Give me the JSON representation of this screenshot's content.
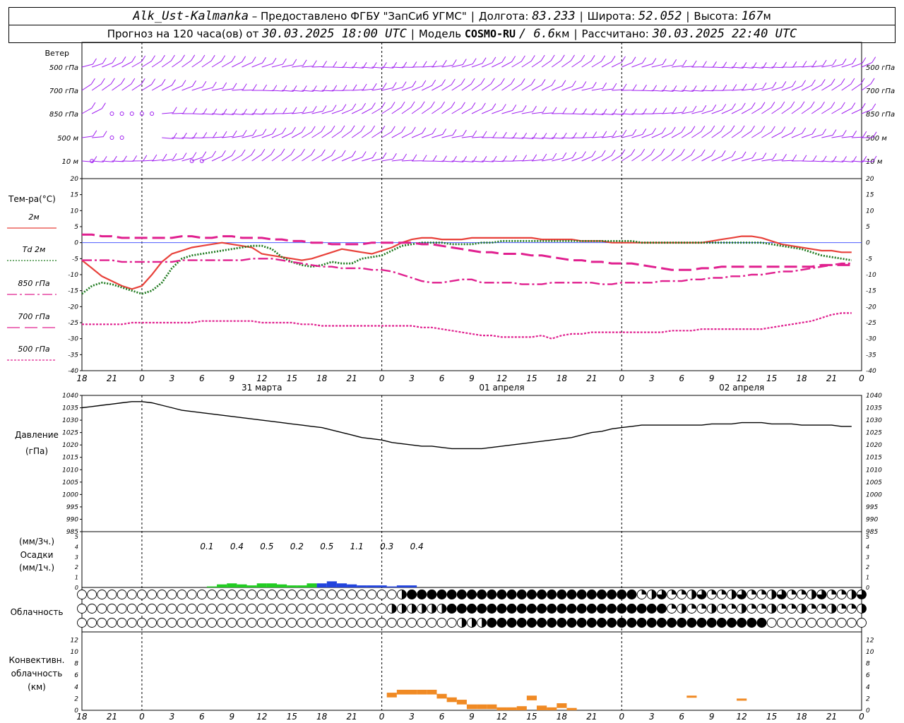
{
  "header": {
    "station": "Alk_Ust-Kalmanka",
    "provider": "– Предоставлено ФГБУ \"ЗапСиб УГМС\"",
    "lon_label": "Долгота:",
    "lon_value": "83.233",
    "lat_label": "Широта:",
    "lat_value": "52.052",
    "alt_label": "Высота:",
    "alt_value": "167",
    "alt_unit": "м",
    "forecast_prefix": "Прогноз на 120 часа(ов) от",
    "forecast_time": "30.03.2025 18:00 UTC",
    "model_label": "Модель",
    "model_name": "COSMO-RU",
    "model_res": "/ 6.6",
    "model_res_unit": "км",
    "calc_label": "Рассчитано:",
    "calc_time": "30.03.2025 22:40 UTC"
  },
  "colors": {
    "wind": "#a020f0",
    "t2m": "#e8413a",
    "td2m": "#1f7a1f",
    "t850": "#e0208f",
    "t700": "#e0208f",
    "t500": "#e0208f",
    "pressure": "#000000",
    "precip_green": "#22cc22",
    "precip_blue": "#2244dd",
    "conv": "#f08a24"
  },
  "wind_panel": {
    "title": "Ветер",
    "levels": [
      "500 гПа",
      "700 гПа",
      "850 гПа",
      "500 м",
      "10  м"
    ]
  },
  "temp_panel": {
    "title": "Тем-ра(°С)",
    "legend": [
      {
        "label": "2м",
        "style": "solid"
      },
      {
        "label": "Td  2м",
        "style": "dotted"
      },
      {
        "label": "850 гПа",
        "style": "dash-dot"
      },
      {
        "label": "700 гПа",
        "style": "long-dash"
      },
      {
        "label": "500 гПа",
        "style": "short-dash"
      }
    ],
    "yticks": [
      20,
      15,
      10,
      5,
      0,
      -5,
      -10,
      -15,
      -20,
      -25,
      -30,
      -35,
      -40
    ]
  },
  "pressure_panel": {
    "title": "Давление",
    "unit": "(гПа)",
    "yticks": [
      1040,
      1035,
      1030,
      1025,
      1020,
      1015,
      1010,
      1005,
      1000,
      995,
      990,
      985
    ]
  },
  "precip_panel": {
    "unit3": "(мм/3ч.)",
    "title": "Осадки",
    "unit1": "(мм/1ч.)",
    "yticks": [
      5,
      4,
      3,
      2,
      1,
      0
    ],
    "labels": [
      "0.1",
      "0.4",
      "0.5",
      "0.2",
      "0.5",
      "1.1",
      "0.3",
      "0.4"
    ]
  },
  "cloud_panel": {
    "title": "Облачность"
  },
  "conv_panel": {
    "title1": "Конвективн.",
    "title2": "облачность",
    "unit": "(км)",
    "yticks": [
      12,
      10,
      8,
      6,
      4,
      2,
      0
    ]
  },
  "time_axis": {
    "hour_ticks": [
      "18",
      "21",
      "0",
      "3",
      "6",
      "9",
      "12",
      "15",
      "18",
      "21",
      "0",
      "3",
      "6",
      "9",
      "12",
      "15",
      "18",
      "21",
      "0",
      "3",
      "6",
      "9",
      "12",
      "15",
      "18",
      "21",
      "0"
    ],
    "dates": [
      "31 марта",
      "01 апреля",
      "02 апреля"
    ]
  },
  "chart_data": {
    "type": "line",
    "title": "Alk_Ust-Kalmanka",
    "x_hours_from_start": [
      0,
      78
    ],
    "series": [
      {
        "name": "2м",
        "unit": "°С",
        "values": [
          -5.5,
          -8,
          -10.5,
          -12,
          -13.5,
          -14.5,
          -13.5,
          -10,
          -6,
          -3.5,
          -2.5,
          -1.5,
          -1,
          -0.5,
          0,
          -0.5,
          -1,
          -1.5,
          -3.5,
          -4,
          -4.5,
          -5,
          -5.5,
          -5,
          -4,
          -3,
          -2,
          -2.5,
          -3,
          -3.5,
          -2.5,
          -1.5,
          0,
          1,
          1.5,
          1.5,
          1,
          1,
          1,
          1.5,
          1.5,
          1.5,
          1.5,
          1.5,
          1.5,
          1.5,
          1,
          1,
          1,
          1,
          0.5,
          0.5,
          0.5,
          0,
          0,
          0,
          0,
          0,
          0,
          0,
          0,
          0,
          0,
          0.5,
          1,
          1.5,
          2,
          2,
          1.5,
          0.5,
          -0.5,
          -1,
          -1.5,
          -2,
          -2.5,
          -2.5,
          -3,
          -3
        ]
      },
      {
        "name": "Td  2м",
        "unit": "°С",
        "values": [
          -16,
          -13.5,
          -12.5,
          -13,
          -14,
          -15,
          -16,
          -15,
          -12.5,
          -8,
          -5,
          -4,
          -3.5,
          -3,
          -2.5,
          -2,
          -1.5,
          -1,
          -1,
          -2,
          -4.5,
          -6,
          -7,
          -7.5,
          -7,
          -6,
          -6.5,
          -6.5,
          -5,
          -4.5,
          -4,
          -2.5,
          -1,
          -0.5,
          0,
          0,
          0,
          -0.5,
          -0.5,
          -0.5,
          0,
          0,
          0.5,
          0.5,
          0.5,
          0.5,
          0.5,
          0.5,
          0.5,
          0.5,
          0.5,
          0.5,
          0.5,
          0.5,
          0.5,
          0.5,
          0,
          0,
          0,
          0,
          0,
          0,
          0,
          0,
          0,
          0,
          0,
          0,
          0,
          -0.5,
          -1,
          -1.5,
          -2,
          -3,
          -4,
          -4.5,
          -5,
          -5.5
        ]
      },
      {
        "name": "850 гПа",
        "unit": "°С",
        "values": [
          -5.5,
          -5.5,
          -5.5,
          -5.5,
          -6,
          -6,
          -6,
          -6,
          -6,
          -6,
          -5.5,
          -5.5,
          -5.5,
          -5.5,
          -5.5,
          -5.5,
          -5.5,
          -5,
          -5,
          -5,
          -5.5,
          -6,
          -6.5,
          -7,
          -7.5,
          -7.5,
          -8,
          -8,
          -8,
          -8.5,
          -8.5,
          -9,
          -10,
          -11,
          -12,
          -12.5,
          -12.5,
          -12,
          -11.5,
          -11.5,
          -12.5,
          -12.5,
          -12.5,
          -12.5,
          -13,
          -13,
          -13,
          -12.5,
          -12.5,
          -12.5,
          -12.5,
          -12.5,
          -13,
          -13,
          -12.5,
          -12.5,
          -12.5,
          -12.5,
          -12,
          -12,
          -12,
          -11.5,
          -11.5,
          -11,
          -11,
          -10.5,
          -10.5,
          -10,
          -10,
          -9.5,
          -9,
          -9,
          -8.5,
          -8,
          -7.5,
          -7,
          -6.5,
          -6.5
        ]
      },
      {
        "name": "700 гПа",
        "unit": "°С",
        "values": [
          2.5,
          2.5,
          2,
          2,
          1.5,
          1.5,
          1.5,
          1.5,
          1.5,
          1.5,
          2,
          2,
          1.5,
          1.5,
          2,
          2,
          1.5,
          1.5,
          1.5,
          1,
          1,
          0.5,
          0.5,
          0,
          0,
          -0.5,
          -0.5,
          -0.5,
          -0.5,
          0,
          0,
          0,
          0,
          0,
          -0.5,
          -0.5,
          -1,
          -1.5,
          -2,
          -2.5,
          -3,
          -3,
          -3.5,
          -3.5,
          -3.5,
          -4,
          -4,
          -4.5,
          -5,
          -5.5,
          -5.5,
          -6,
          -6,
          -6.5,
          -6.5,
          -6.5,
          -7,
          -7.5,
          -8,
          -8.5,
          -8.5,
          -8.5,
          -8,
          -8,
          -7.5,
          -7.5,
          -7.5,
          -7.5,
          -7.5,
          -7.5,
          -7.5,
          -7.5,
          -7.5,
          -7.5,
          -7,
          -7,
          -7,
          -7
        ]
      },
      {
        "name": "500 гПа",
        "unit": "°С",
        "values": [
          -25.5,
          -25.5,
          -25.5,
          -25.5,
          -25.5,
          -25,
          -25,
          -25,
          -25,
          -25,
          -25,
          -25,
          -24.5,
          -24.5,
          -24.5,
          -24.5,
          -24.5,
          -24.5,
          -25,
          -25,
          -25,
          -25,
          -25.5,
          -25.5,
          -26,
          -26,
          -26,
          -26,
          -26,
          -26,
          -26,
          -26,
          -26,
          -26,
          -26.5,
          -26.5,
          -27,
          -27.5,
          -28,
          -28.5,
          -29,
          -29,
          -29.5,
          -29.5,
          -29.5,
          -29.5,
          -29,
          -30,
          -29,
          -28.5,
          -28.5,
          -28,
          -28,
          -28,
          -28,
          -28,
          -28,
          -28,
          -28,
          -27.5,
          -27.5,
          -27.5,
          -27,
          -27,
          -27,
          -27,
          -27,
          -27,
          -27,
          -26.5,
          -26,
          -25.5,
          -25,
          -24.5,
          -23.5,
          -22.5,
          -22,
          -22
        ]
      },
      {
        "name": "Давление",
        "unit": "гПа",
        "values": [
          1035,
          1035.5,
          1036,
          1036.5,
          1037,
          1037.5,
          1037.5,
          1037,
          1036,
          1035,
          1034,
          1033.5,
          1033,
          1032.5,
          1032,
          1031.5,
          1031,
          1030.5,
          1030,
          1029.5,
          1029,
          1028.5,
          1028,
          1027.5,
          1027,
          1026,
          1025,
          1024,
          1023,
          1022.5,
          1022,
          1021,
          1020.5,
          1020,
          1019.5,
          1019.5,
          1019,
          1018.5,
          1018.5,
          1018.5,
          1018.5,
          1019,
          1019.5,
          1020,
          1020.5,
          1021,
          1021.5,
          1022,
          1022.5,
          1023,
          1024,
          1025,
          1025.5,
          1026.5,
          1027,
          1027.5,
          1028,
          1028,
          1028,
          1028,
          1028,
          1028,
          1028,
          1028.5,
          1028.5,
          1028.5,
          1029,
          1029,
          1029,
          1028.5,
          1028.5,
          1028.5,
          1028,
          1028,
          1028,
          1028,
          1027.5,
          1027.5
        ]
      }
    ],
    "precip_mm_1h": [
      {
        "hour": 13,
        "value": 0.1
      },
      {
        "hour": 14,
        "value": 0.3
      },
      {
        "hour": 15,
        "value": 0.4
      },
      {
        "hour": 16,
        "value": 0.3
      },
      {
        "hour": 17,
        "value": 0.2
      },
      {
        "hour": 18,
        "value": 0.4
      },
      {
        "hour": 19,
        "value": 0.4
      },
      {
        "hour": 20,
        "value": 0.3
      },
      {
        "hour": 21,
        "value": 0.2
      },
      {
        "hour": 22,
        "value": 0.2
      },
      {
        "hour": 23,
        "value": 0.4
      },
      {
        "hour": 24,
        "value": 0.4
      },
      {
        "hour": 25,
        "value": 0.6
      },
      {
        "hour": 26,
        "value": 0.4
      },
      {
        "hour": 27,
        "value": 0.3
      },
      {
        "hour": 28,
        "value": 0.2
      },
      {
        "hour": 29,
        "value": 0.2
      },
      {
        "hour": 30,
        "value": 0.2
      },
      {
        "hour": 31,
        "value": 0.1
      },
      {
        "hour": 32,
        "value": 0.2
      },
      {
        "hour": 33,
        "value": 0.2
      }
    ],
    "conv_cloud_km": [
      {
        "hour": 1,
        "value": 3
      },
      {
        "hour": 2,
        "value": 3.5
      },
      {
        "hour": 3,
        "value": 3.5
      },
      {
        "hour": 4,
        "value": 3.5
      },
      {
        "hour": 5,
        "value": 3.5
      },
      {
        "hour": 6,
        "value": 2.8
      },
      {
        "hour": 7,
        "value": 2.2
      },
      {
        "hour": 8,
        "value": 1.8
      },
      {
        "hour": 9,
        "value": 1.0
      },
      {
        "hour": 10,
        "value": 1.0
      },
      {
        "hour": 11,
        "value": 1.0
      },
      {
        "hour": 12,
        "value": 0.5
      },
      {
        "hour": 13,
        "value": 0.5
      },
      {
        "hour": 14,
        "value": 0.7
      },
      {
        "hour": 15,
        "value": 2.5
      },
      {
        "hour": 16,
        "value": 0.8
      },
      {
        "hour": 17,
        "value": 0.5
      },
      {
        "hour": 18,
        "value": 1.2
      },
      {
        "hour": 19,
        "value": 0.4
      }
    ]
  }
}
